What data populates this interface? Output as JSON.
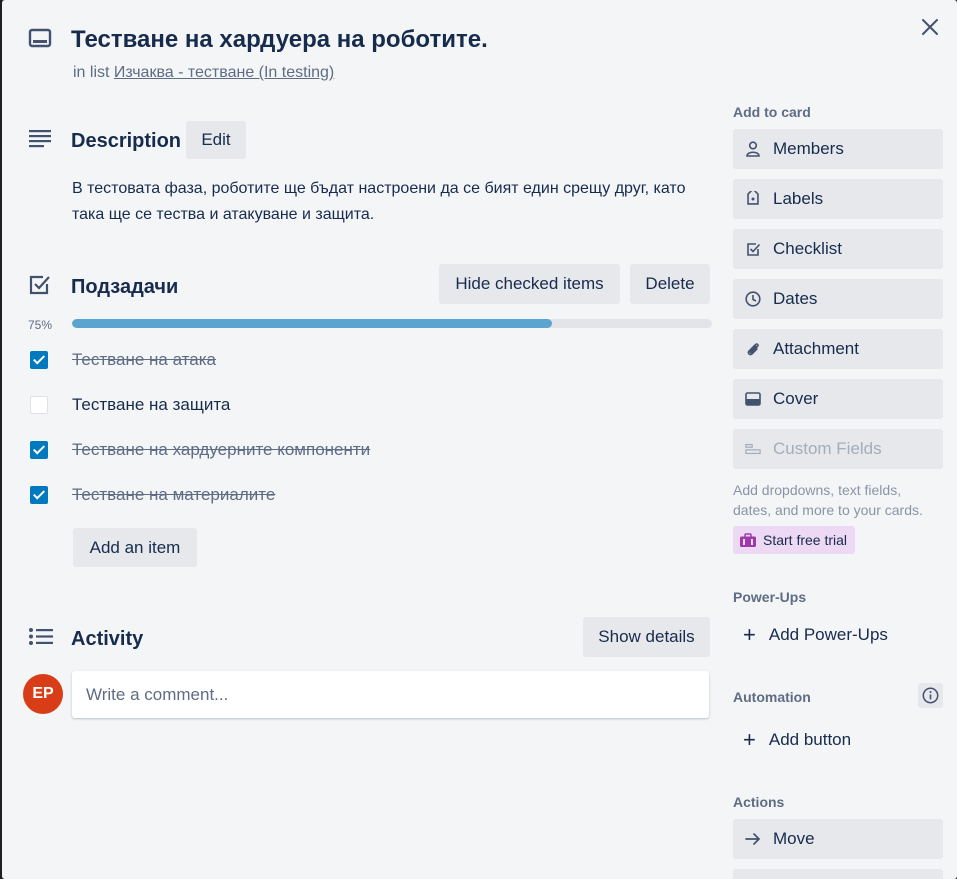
{
  "card": {
    "title": "Тестване на хардуера на роботите.",
    "in_list_prefix": "in list",
    "list_name": "Изчаква - тестване (In testing)"
  },
  "description": {
    "title": "Description",
    "edit_label": "Edit",
    "text": "В тестовата фаза, роботите ще бъдат настроени да се бият един срещу друг, като така ще се тества и атакуване и защита."
  },
  "checklist": {
    "title": "Подзадачи",
    "hide_checked_label": "Hide checked items",
    "delete_label": "Delete",
    "percent_label": "75%",
    "progress": 0.75,
    "items": [
      {
        "label": "Тестване на атака",
        "checked": true
      },
      {
        "label": "Тестване на защита",
        "checked": false
      },
      {
        "label": "Тестване на хардуерните компоненти",
        "checked": true
      },
      {
        "label": "Тестване на материалите",
        "checked": true
      }
    ],
    "add_item_label": "Add an item"
  },
  "activity": {
    "title": "Activity",
    "show_details_label": "Show details",
    "avatar_initials": "EP",
    "comment_placeholder": "Write a comment..."
  },
  "sidebar": {
    "add_to_card_heading": "Add to card",
    "buttons": [
      {
        "label": "Members",
        "icon": "person-icon"
      },
      {
        "label": "Labels",
        "icon": "tag-icon"
      },
      {
        "label": "Checklist",
        "icon": "checklist-icon"
      },
      {
        "label": "Dates",
        "icon": "clock-icon"
      },
      {
        "label": "Attachment",
        "icon": "paperclip-icon"
      },
      {
        "label": "Cover",
        "icon": "cover-icon"
      },
      {
        "label": "Custom Fields",
        "icon": "custom-fields-icon"
      }
    ],
    "custom_fields_note": "Add dropdowns, text fields, dates, and more to your cards.",
    "start_trial_label": "Start free trial",
    "powerups_heading": "Power-Ups",
    "add_powerups_label": "Add Power-Ups",
    "automation_heading": "Automation",
    "add_button_label": "Add button",
    "actions_heading": "Actions",
    "move_label": "Move"
  },
  "colors": {
    "accent": "#0079bf",
    "progress": "#5ba4cf",
    "avatar": "#d93d17",
    "trial_bg": "#eed9f4"
  }
}
